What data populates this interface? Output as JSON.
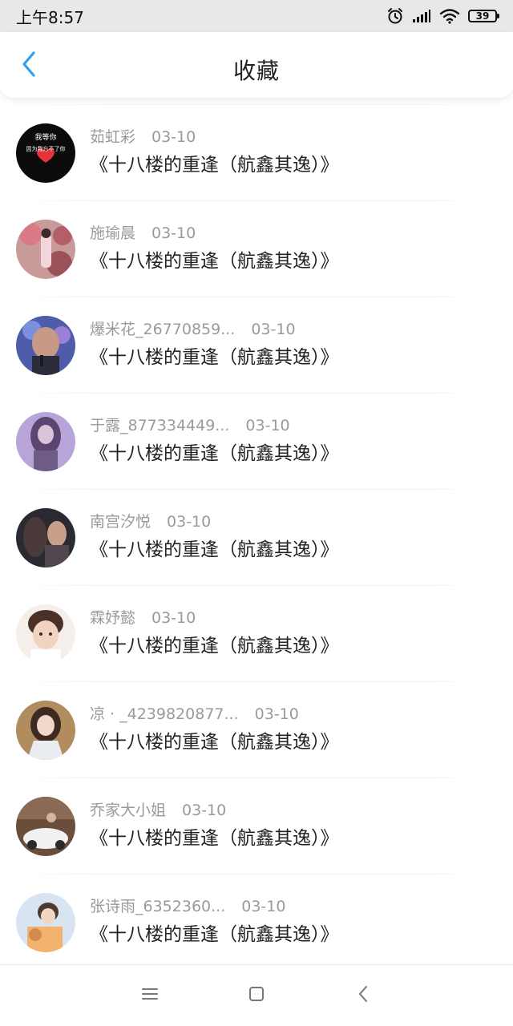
{
  "status_bar": {
    "time": "上午8:57",
    "battery": "39",
    "icons": [
      "alarm-icon",
      "signal-icon",
      "wifi-icon",
      "battery-icon"
    ]
  },
  "header": {
    "title": "收藏",
    "back_icon": "chevron-left-icon",
    "accent_color": "#2aa3f0"
  },
  "favorites": [
    {
      "username": "茹虹彩",
      "date": "03-10",
      "title": "《十八楼的重逢（航鑫其逸）》",
      "avatar_text": [
        "我等你",
        "因为我忘不了你"
      ]
    },
    {
      "username": "施瑜晨",
      "date": "03-10",
      "title": "《十八楼的重逢（航鑫其逸）》"
    },
    {
      "username": "爆米花_26770859...",
      "date": "03-10",
      "title": "《十八楼的重逢（航鑫其逸）》"
    },
    {
      "username": "于露_877334449...",
      "date": "03-10",
      "title": "《十八楼的重逢（航鑫其逸）》"
    },
    {
      "username": "南宫汐悦",
      "date": "03-10",
      "title": "《十八楼的重逢（航鑫其逸）》"
    },
    {
      "username": "霖妤懿",
      "date": "03-10",
      "title": "《十八楼的重逢（航鑫其逸）》"
    },
    {
      "username": "凉 · _4239820877...",
      "date": "03-10",
      "title": "《十八楼的重逢（航鑫其逸）》"
    },
    {
      "username": "乔家大小姐",
      "date": "03-10",
      "title": "《十八楼的重逢（航鑫其逸）》"
    },
    {
      "username": "张诗雨_6352360...",
      "date": "03-10",
      "title": "《十八楼的重逢（航鑫其逸）》"
    }
  ],
  "nav_bar": {
    "buttons": [
      "menu-icon",
      "home-icon",
      "back-icon"
    ]
  }
}
